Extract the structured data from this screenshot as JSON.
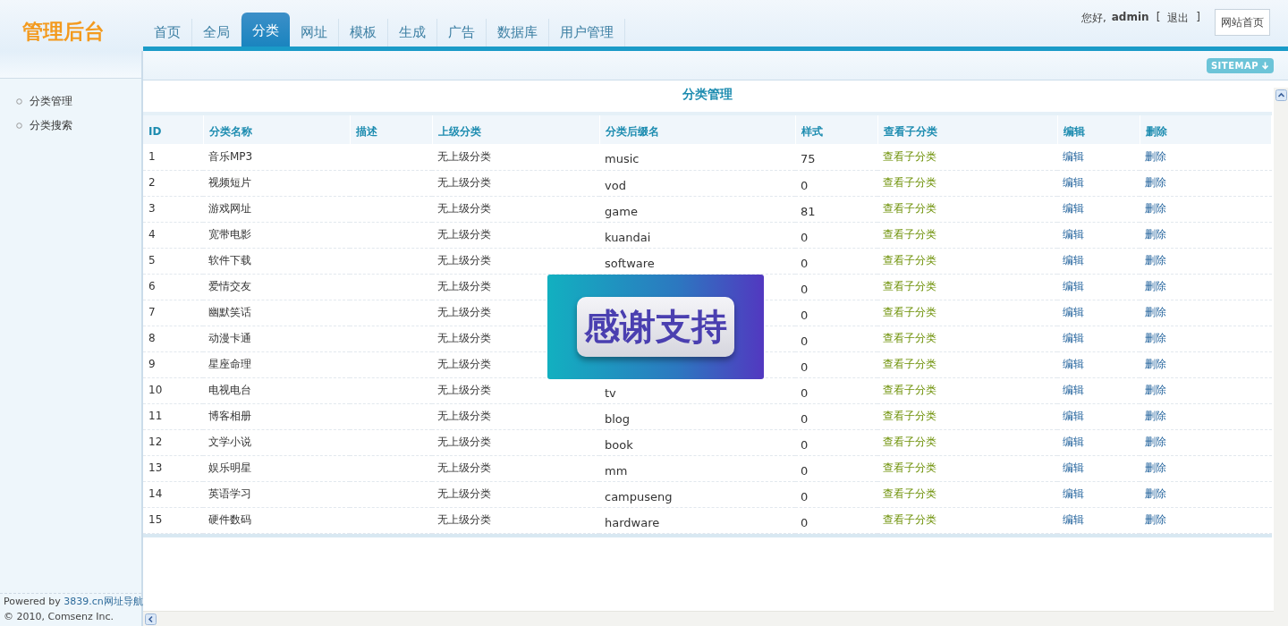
{
  "logo": "管理后台",
  "nav": [
    {
      "label": "首页",
      "selected": false
    },
    {
      "label": "全局",
      "selected": false
    },
    {
      "label": "分类",
      "selected": true
    },
    {
      "label": "网址",
      "selected": false
    },
    {
      "label": "模板",
      "selected": false
    },
    {
      "label": "生成",
      "selected": false
    },
    {
      "label": "广告",
      "selected": false
    },
    {
      "label": "数据库",
      "selected": false
    },
    {
      "label": "用户管理",
      "selected": false
    }
  ],
  "user": {
    "greeting": "您好,",
    "name": "admin",
    "logout_open": "[",
    "logout": "退出",
    "logout_close": "]",
    "home_button": "网站首页"
  },
  "sitemap": "SITEMAP",
  "sidebar": {
    "items": [
      {
        "label": "分类管理"
      },
      {
        "label": "分类搜索"
      }
    ],
    "powered": "Powered by",
    "powered_link": "3839.cn网址导航",
    "copyright": "© 2010, Comsenz Inc."
  },
  "title": "分类管理",
  "table": {
    "columns": [
      "ID",
      "分类名称",
      "描述",
      "上级分类",
      "分类后缀名",
      "样式",
      "查看子分类",
      "编辑",
      "删除"
    ],
    "rows": [
      {
        "id": "1",
        "name": "音乐MP3",
        "parent": "无上级分类",
        "alias": "music",
        "style": "75",
        "view": "查看子分类",
        "edit": "编辑",
        "delete": "删除"
      },
      {
        "id": "2",
        "name": "视频短片",
        "parent": "无上级分类",
        "alias": "vod",
        "style": "0",
        "view": "查看子分类",
        "edit": "编辑",
        "delete": "删除"
      },
      {
        "id": "3",
        "name": "游戏网址",
        "parent": "无上级分类",
        "alias": "game",
        "style": "81",
        "view": "查看子分类",
        "edit": "编辑",
        "delete": "删除"
      },
      {
        "id": "4",
        "name": "宽带电影",
        "parent": "无上级分类",
        "alias": "kuandai",
        "style": "0",
        "view": "查看子分类",
        "edit": "编辑",
        "delete": "删除"
      },
      {
        "id": "5",
        "name": "软件下载",
        "parent": "无上级分类",
        "alias": "software",
        "style": "0",
        "view": "查看子分类",
        "edit": "编辑",
        "delete": "删除"
      },
      {
        "id": "6",
        "name": "爱情交友",
        "parent": "无上级分类",
        "style": "0",
        "view": "查看子分类",
        "edit": "编辑",
        "delete": "删除"
      },
      {
        "id": "7",
        "name": "幽默笑话",
        "parent": "无上级分类",
        "style": "0",
        "view": "查看子分类",
        "edit": "编辑",
        "delete": "删除"
      },
      {
        "id": "8",
        "name": "动漫卡通",
        "parent": "无上级分类",
        "style": "0",
        "view": "查看子分类",
        "edit": "编辑",
        "delete": "删除"
      },
      {
        "id": "9",
        "name": "星座命理",
        "parent": "无上级分类",
        "style": "0",
        "view": "查看子分类",
        "edit": "编辑",
        "delete": "删除"
      },
      {
        "id": "10",
        "name": "电视电台",
        "parent": "无上级分类",
        "alias": "tv",
        "style": "0",
        "view": "查看子分类",
        "edit": "编辑",
        "delete": "删除"
      },
      {
        "id": "11",
        "name": "博客相册",
        "parent": "无上级分类",
        "alias": "blog",
        "style": "0",
        "view": "查看子分类",
        "edit": "编辑",
        "delete": "删除"
      },
      {
        "id": "12",
        "name": "文学小说",
        "parent": "无上级分类",
        "alias": "book",
        "style": "0",
        "view": "查看子分类",
        "edit": "编辑",
        "delete": "删除"
      },
      {
        "id": "13",
        "name": "娱乐明星",
        "parent": "无上级分类",
        "alias": "mm",
        "style": "0",
        "view": "查看子分类",
        "edit": "编辑",
        "delete": "删除"
      },
      {
        "id": "14",
        "name": "英语学习",
        "parent": "无上级分类",
        "alias": "campuseng",
        "style": "0",
        "view": "查看子分类",
        "edit": "编辑",
        "delete": "删除"
      },
      {
        "id": "15",
        "name": "硬件数码",
        "parent": "无上级分类",
        "alias": "hardware",
        "style": "0",
        "view": "查看子分类",
        "edit": "编辑",
        "delete": "删除"
      }
    ]
  },
  "overlay": {
    "text": "感谢支持"
  }
}
